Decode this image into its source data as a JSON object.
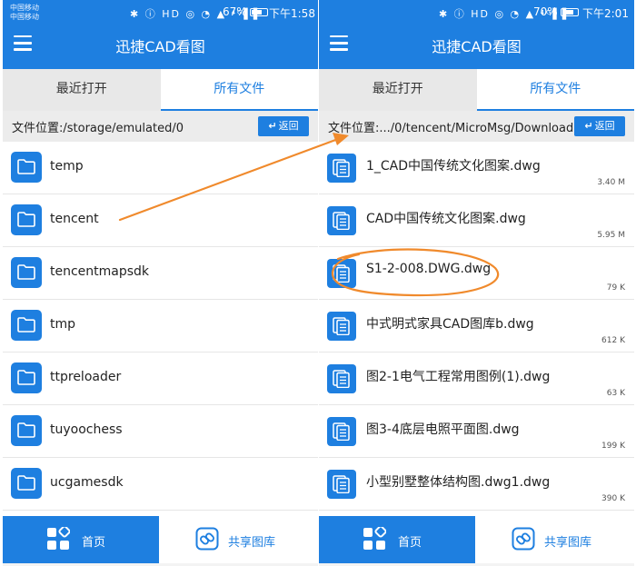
{
  "left": {
    "status": {
      "carrier1": "中国移动",
      "carrier2": "中国移动",
      "icons": "✱ ⓘ HD ◎ ◔ ▲ ⁴ᴳ▌▌",
      "battery": "67%",
      "time": "下午1:58"
    },
    "title": "迅捷CAD看图",
    "tabs": [
      "最近打开",
      "所有文件"
    ],
    "path": "文件位置:/storage/emulated/0",
    "back_label": "返回",
    "folders": [
      "temp",
      "tencent",
      "tencentmapsdk",
      "tmp",
      "ttpreloader",
      "tuyoochess",
      "ucgamesdk"
    ],
    "nav": {
      "home": "首页",
      "share": "共享图库"
    }
  },
  "right": {
    "status": {
      "carrier1": "",
      "carrier2": "",
      "icons": "✱ ⓘ HD ◎ ◔ ▲ ⁴ᴳ▌▌",
      "battery": "70%",
      "time": "下午2:01"
    },
    "title": "迅捷CAD看图",
    "tabs": [
      "最近打开",
      "所有文件"
    ],
    "path": "文件位置:.../0/tencent/MicroMsg/Download",
    "back_label": "返回",
    "files": [
      {
        "name": "1_CAD中国传统文化图案.dwg",
        "size": "3.40 M"
      },
      {
        "name": "CAD中国传统文化图案.dwg",
        "size": "5.95 M"
      },
      {
        "name": "S1-2-008.DWG.dwg",
        "size": "79 K"
      },
      {
        "name": "中式明式家具CAD图库b.dwg",
        "size": "612 K"
      },
      {
        "name": "图2-1电气工程常用图例(1).dwg",
        "size": "63 K"
      },
      {
        "name": "图3-4底层电照平面图.dwg",
        "size": "199 K"
      },
      {
        "name": "小型别墅整体结构图.dwg1.dwg",
        "size": "390 K"
      }
    ],
    "nav": {
      "home": "首页",
      "share": "共享图库"
    }
  },
  "colors": {
    "primary": "#1e7fe0",
    "annotation": "#f08a2c"
  }
}
